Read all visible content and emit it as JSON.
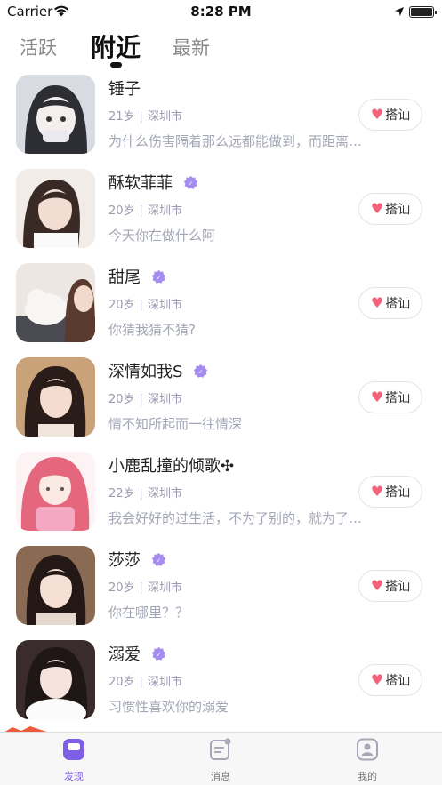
{
  "status_bar": {
    "carrier": "Carrier",
    "time": "8:28 PM"
  },
  "tabs": [
    {
      "label": "活跃",
      "active": false
    },
    {
      "label": "附近",
      "active": true
    },
    {
      "label": "最新",
      "active": false
    }
  ],
  "accent_color": "#7f5fe6",
  "greet_label": "搭讪",
  "users": [
    {
      "name": "锤子",
      "verified": false,
      "age": "21岁",
      "city": "深圳市",
      "message": "为什么伤害隔着那么远都能做到，而距离却不可以？"
    },
    {
      "name": "酥软菲菲",
      "verified": true,
      "age": "20岁",
      "city": "深圳市",
      "message": "今天你在做什么阿"
    },
    {
      "name": "甜尾",
      "verified": true,
      "age": "20岁",
      "city": "深圳市",
      "message": "你猜我猜不猜?"
    },
    {
      "name": "深情如我S",
      "verified": true,
      "age": "20岁",
      "city": "深圳市",
      "message": "情不知所起而一往情深"
    },
    {
      "name": "小鹿乱撞的倾歌✣",
      "verified": false,
      "age": "22岁",
      "city": "深圳市",
      "message": "我会好好的过生活，不为了别的，就为了不辜负自己。"
    },
    {
      "name": "莎莎",
      "verified": true,
      "age": "20岁",
      "city": "深圳市",
      "message": "你在哪里？？"
    },
    {
      "name": "溺爱",
      "verified": true,
      "age": "20岁",
      "city": "深圳市",
      "message": "习惯性喜欢你的溺爱"
    }
  ],
  "tabbar": [
    {
      "label": "发现",
      "icon": "discover-icon",
      "active": true
    },
    {
      "label": "消息",
      "icon": "message-icon",
      "active": false
    },
    {
      "label": "我的",
      "icon": "profile-icon",
      "active": false
    }
  ]
}
